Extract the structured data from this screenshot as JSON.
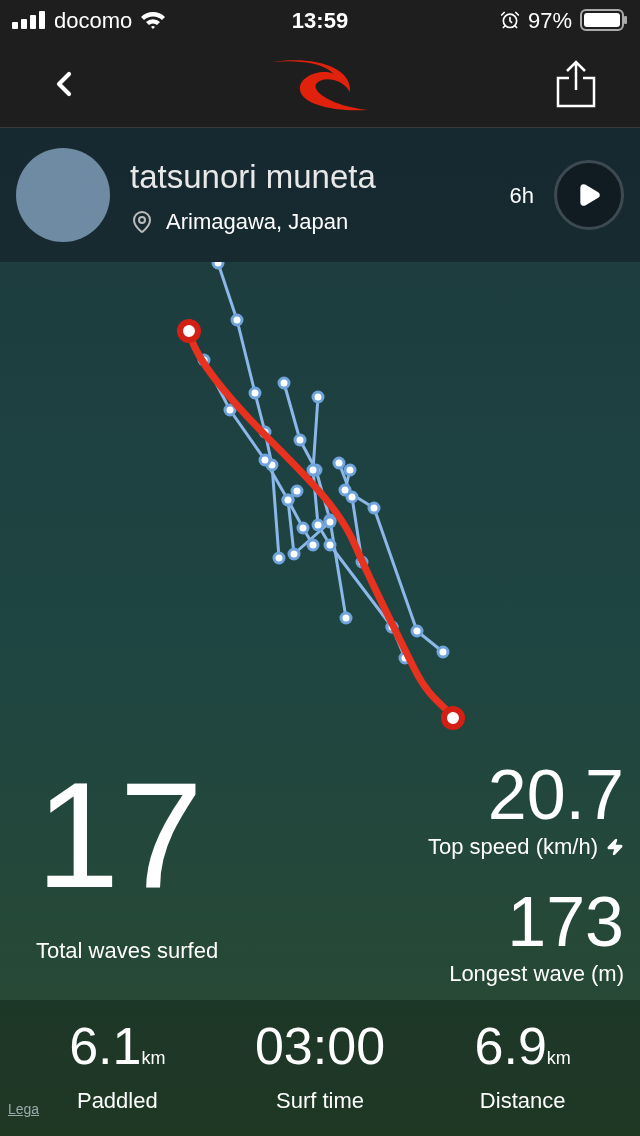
{
  "status_bar": {
    "carrier": "docomo",
    "time": "13:59",
    "battery": "97%"
  },
  "profile": {
    "name": "tatsunori muneta",
    "location": "Arimagawa, Japan",
    "duration": "6h"
  },
  "highlights": {
    "waves": {
      "value": "17",
      "label": "Total waves surfed"
    },
    "top_speed": {
      "value": "20.7",
      "label": "Top speed (km/h)"
    },
    "longest_wave": {
      "value": "173",
      "label": "Longest wave (m)"
    }
  },
  "summary": [
    {
      "value": "6.1",
      "unit": "km",
      "label": "Paddled"
    },
    {
      "value": "03:00",
      "label": "Surf time"
    },
    {
      "value": "6.9",
      "unit": "km",
      "label": "Distance"
    }
  ],
  "legal_link": "Lega"
}
